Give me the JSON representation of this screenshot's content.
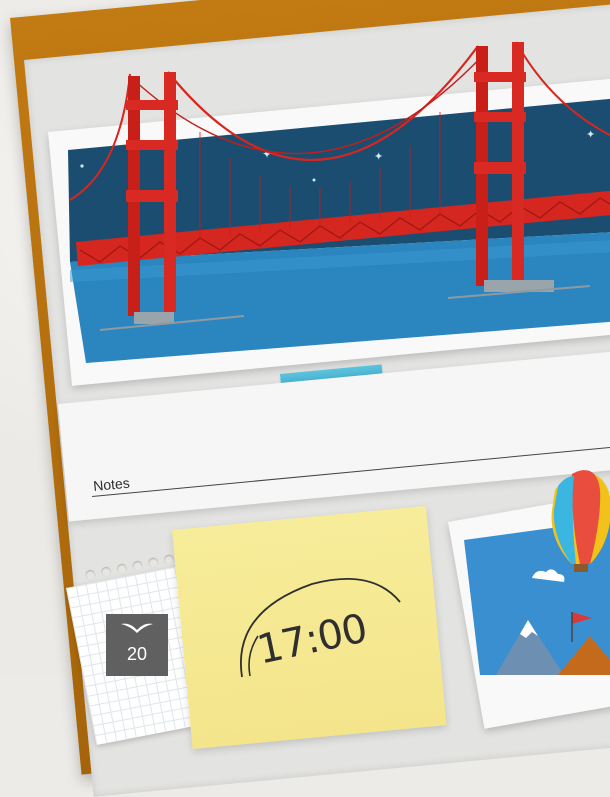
{
  "notes": {
    "label": "Notes"
  },
  "calendar": {
    "day": "20",
    "icon": "gull-icon"
  },
  "sticky_note": {
    "time": "17:00"
  },
  "photos": {
    "bridge_photo": {
      "subject": "golden-gate-bridge-illustration"
    },
    "balloon_photo": {
      "subject": "hot-air-balloon-illustration"
    }
  },
  "colors": {
    "frame": "#b6700f",
    "board": "#e3e3e1",
    "sky": "#1a4f73",
    "water": "#2d8bc4",
    "bridge": "#d8261f",
    "tape": "#4bb7d6",
    "sticky": "#f6e995",
    "calendar": "#606060"
  }
}
